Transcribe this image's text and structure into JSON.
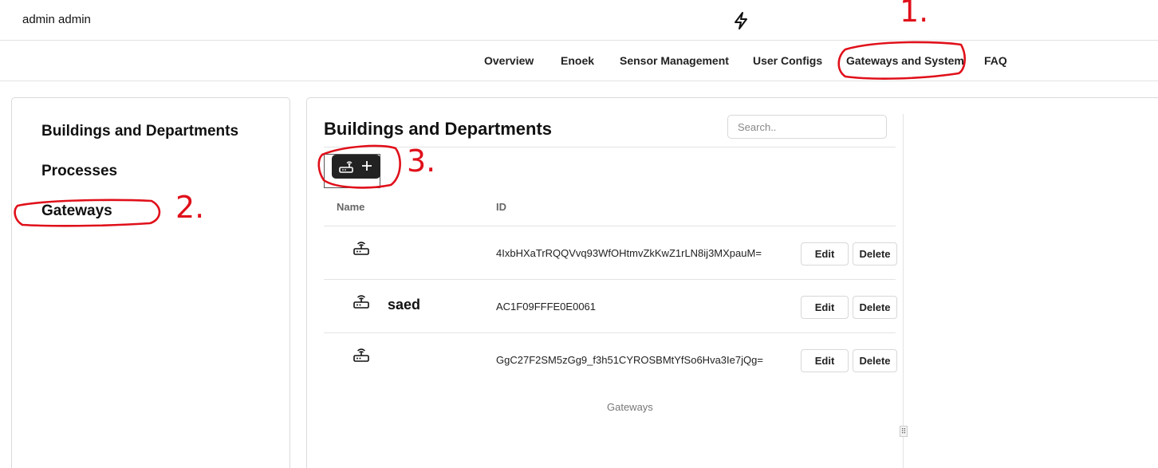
{
  "header": {
    "user_name": "admin admin",
    "logo_icon": "lightning-bolt-icon"
  },
  "nav": {
    "items": [
      "Overview",
      "Enoek",
      "Sensor Management",
      "User Configs",
      "Gateways and System",
      "FAQ"
    ]
  },
  "sidebar": {
    "items": [
      "Buildings and Departments",
      "Processes",
      "Gateways"
    ]
  },
  "panel": {
    "title": "Buildings and Departments",
    "search_placeholder": "Search..",
    "add_button_icons": [
      "router-icon",
      "plus-icon"
    ],
    "columns": [
      "Name",
      "ID"
    ],
    "rows": [
      {
        "name": "",
        "id": "4IxbHXaTrRQQVvq93WfOHtmvZkKwZ1rLN8ij3MXpauM=",
        "edit": "Edit",
        "delete": "Delete"
      },
      {
        "name": "saed",
        "id": "AC1F09FFFE0E0061",
        "edit": "Edit",
        "delete": "Delete"
      },
      {
        "name": "",
        "id": "GgC27F2SM5zGg9_f3h51CYROSBMtYfSo6Hva3Ie7jQg=",
        "edit": "Edit",
        "delete": "Delete"
      }
    ],
    "caption": "Gateways"
  },
  "annotations": {
    "color": "#e0101a",
    "numbers": [
      "1.",
      "2.",
      "3."
    ]
  }
}
